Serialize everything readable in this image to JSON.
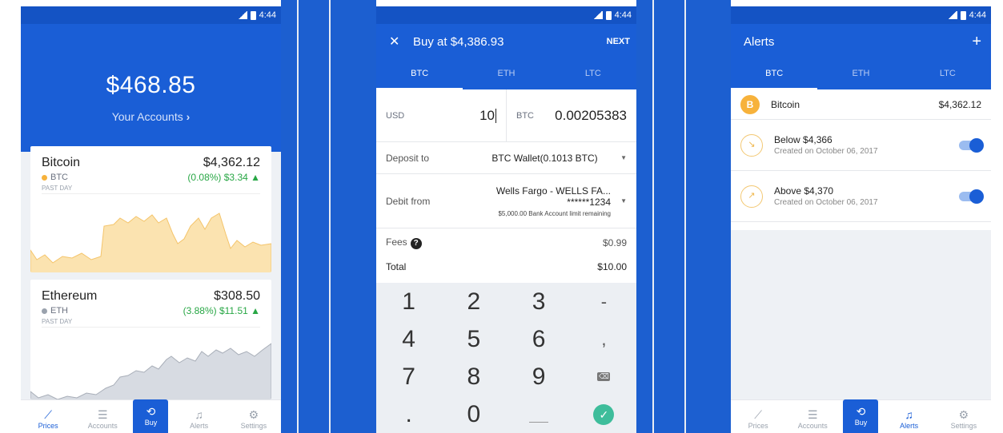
{
  "status": {
    "time": "4:44"
  },
  "colors": {
    "primary": "#1a5ed6",
    "positive": "#28a745",
    "btc": "#f7b23b",
    "eth": "#9aa2ad",
    "confirm": "#3ebd9b"
  },
  "prices_screen": {
    "balance": "$468.85",
    "your_accounts": "Your Accounts",
    "chevron_icon": "chevron-right-icon",
    "cards": [
      {
        "name": "Bitcoin",
        "price": "$4,362.12",
        "symbol": "BTC",
        "change": "(0.08%) $3.34 ▲",
        "period": "PAST DAY"
      },
      {
        "name": "Ethereum",
        "price": "$308.50",
        "symbol": "ETH",
        "change": "(3.88%) $11.51 ▲",
        "period": "PAST DAY"
      }
    ]
  },
  "nav": {
    "prices": "Prices",
    "accounts": "Accounts",
    "buy": "Buy",
    "alerts": "Alerts",
    "settings": "Settings"
  },
  "buy_screen": {
    "title": "Buy at $4,386.93",
    "next": "NEXT",
    "tabs": [
      "BTC",
      "ETH",
      "LTC"
    ],
    "usd_label": "USD",
    "usd_value": "10",
    "btc_label": "BTC",
    "btc_value": "0.00205383",
    "deposit_label": "Deposit to",
    "deposit_value": "BTC Wallet(0.1013 BTC)",
    "debit_label": "Debit from",
    "debit_line1": "Wells Fargo - WELLS FA...",
    "debit_line2": "******1234",
    "debit_note": "$5,000.00 Bank Account limit remaining",
    "fees_label": "Fees",
    "fees_value": "$0.99",
    "total_label": "Total",
    "total_value": "$10.00",
    "keys": [
      "1",
      "2",
      "3",
      "-",
      "4",
      "5",
      "6",
      ",",
      "7",
      "8",
      "9",
      "⌫",
      ".",
      "0",
      "",
      "✓"
    ]
  },
  "alerts_screen": {
    "title": "Alerts",
    "plus": "+",
    "tabs": [
      "BTC",
      "ETH",
      "LTC"
    ],
    "coin": {
      "name": "Bitcoin",
      "price": "$4,362.12",
      "glyph": "B"
    },
    "alerts": [
      {
        "title": "Below $4,366",
        "subtitle": "Created on October 06, 2017",
        "enabled": true
      },
      {
        "title": "Above $4,370",
        "subtitle": "Created on October 06, 2017",
        "enabled": true
      }
    ]
  }
}
